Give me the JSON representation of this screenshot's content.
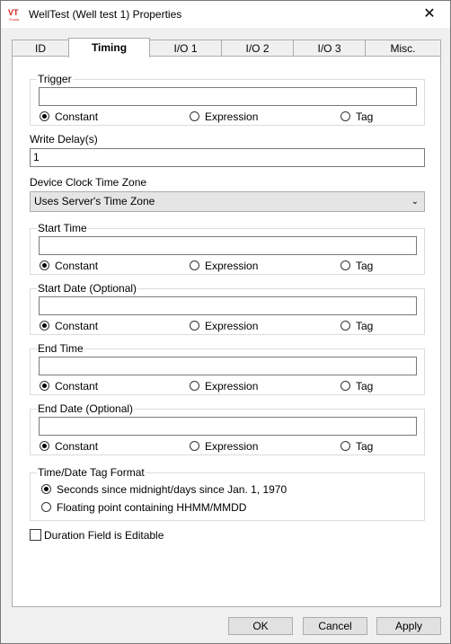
{
  "window": {
    "title": "WellTest (Well test 1) Properties",
    "icon": "vtscada-logo-icon",
    "close": "✕"
  },
  "tabs": [
    {
      "label": "ID",
      "active": false
    },
    {
      "label": "Timing",
      "active": true
    },
    {
      "label": "I/O 1",
      "active": false
    },
    {
      "label": "I/O 2",
      "active": false
    },
    {
      "label": "I/O 3",
      "active": false
    },
    {
      "label": "Misc.",
      "active": false
    }
  ],
  "radio_labels": {
    "constant": "Constant",
    "expression": "Expression",
    "tag": "Tag"
  },
  "trigger": {
    "title": "Trigger",
    "value": "",
    "selected": "Constant"
  },
  "write_delay": {
    "label": "Write Delay(s)",
    "value": "1"
  },
  "time_zone": {
    "label": "Device Clock Time Zone",
    "selected": "Uses Server's Time Zone"
  },
  "start_time": {
    "title": "Start Time",
    "value": "",
    "selected": "Constant"
  },
  "start_date": {
    "title": "Start Date (Optional)",
    "value": "",
    "selected": "Constant"
  },
  "end_time": {
    "title": "End Time",
    "value": "",
    "selected": "Constant"
  },
  "end_date": {
    "title": "End Date (Optional)",
    "value": "",
    "selected": "Constant"
  },
  "tag_format": {
    "title": "Time/Date Tag Format",
    "option_seconds": "Seconds since midnight/days since Jan. 1, 1970",
    "option_float": "Floating point containing HHMM/MMDD",
    "selected": "option_seconds"
  },
  "duration_editable": {
    "label": "Duration Field is Editable",
    "checked": false
  },
  "buttons": {
    "ok": "OK",
    "cancel": "Cancel",
    "apply": "Apply"
  }
}
